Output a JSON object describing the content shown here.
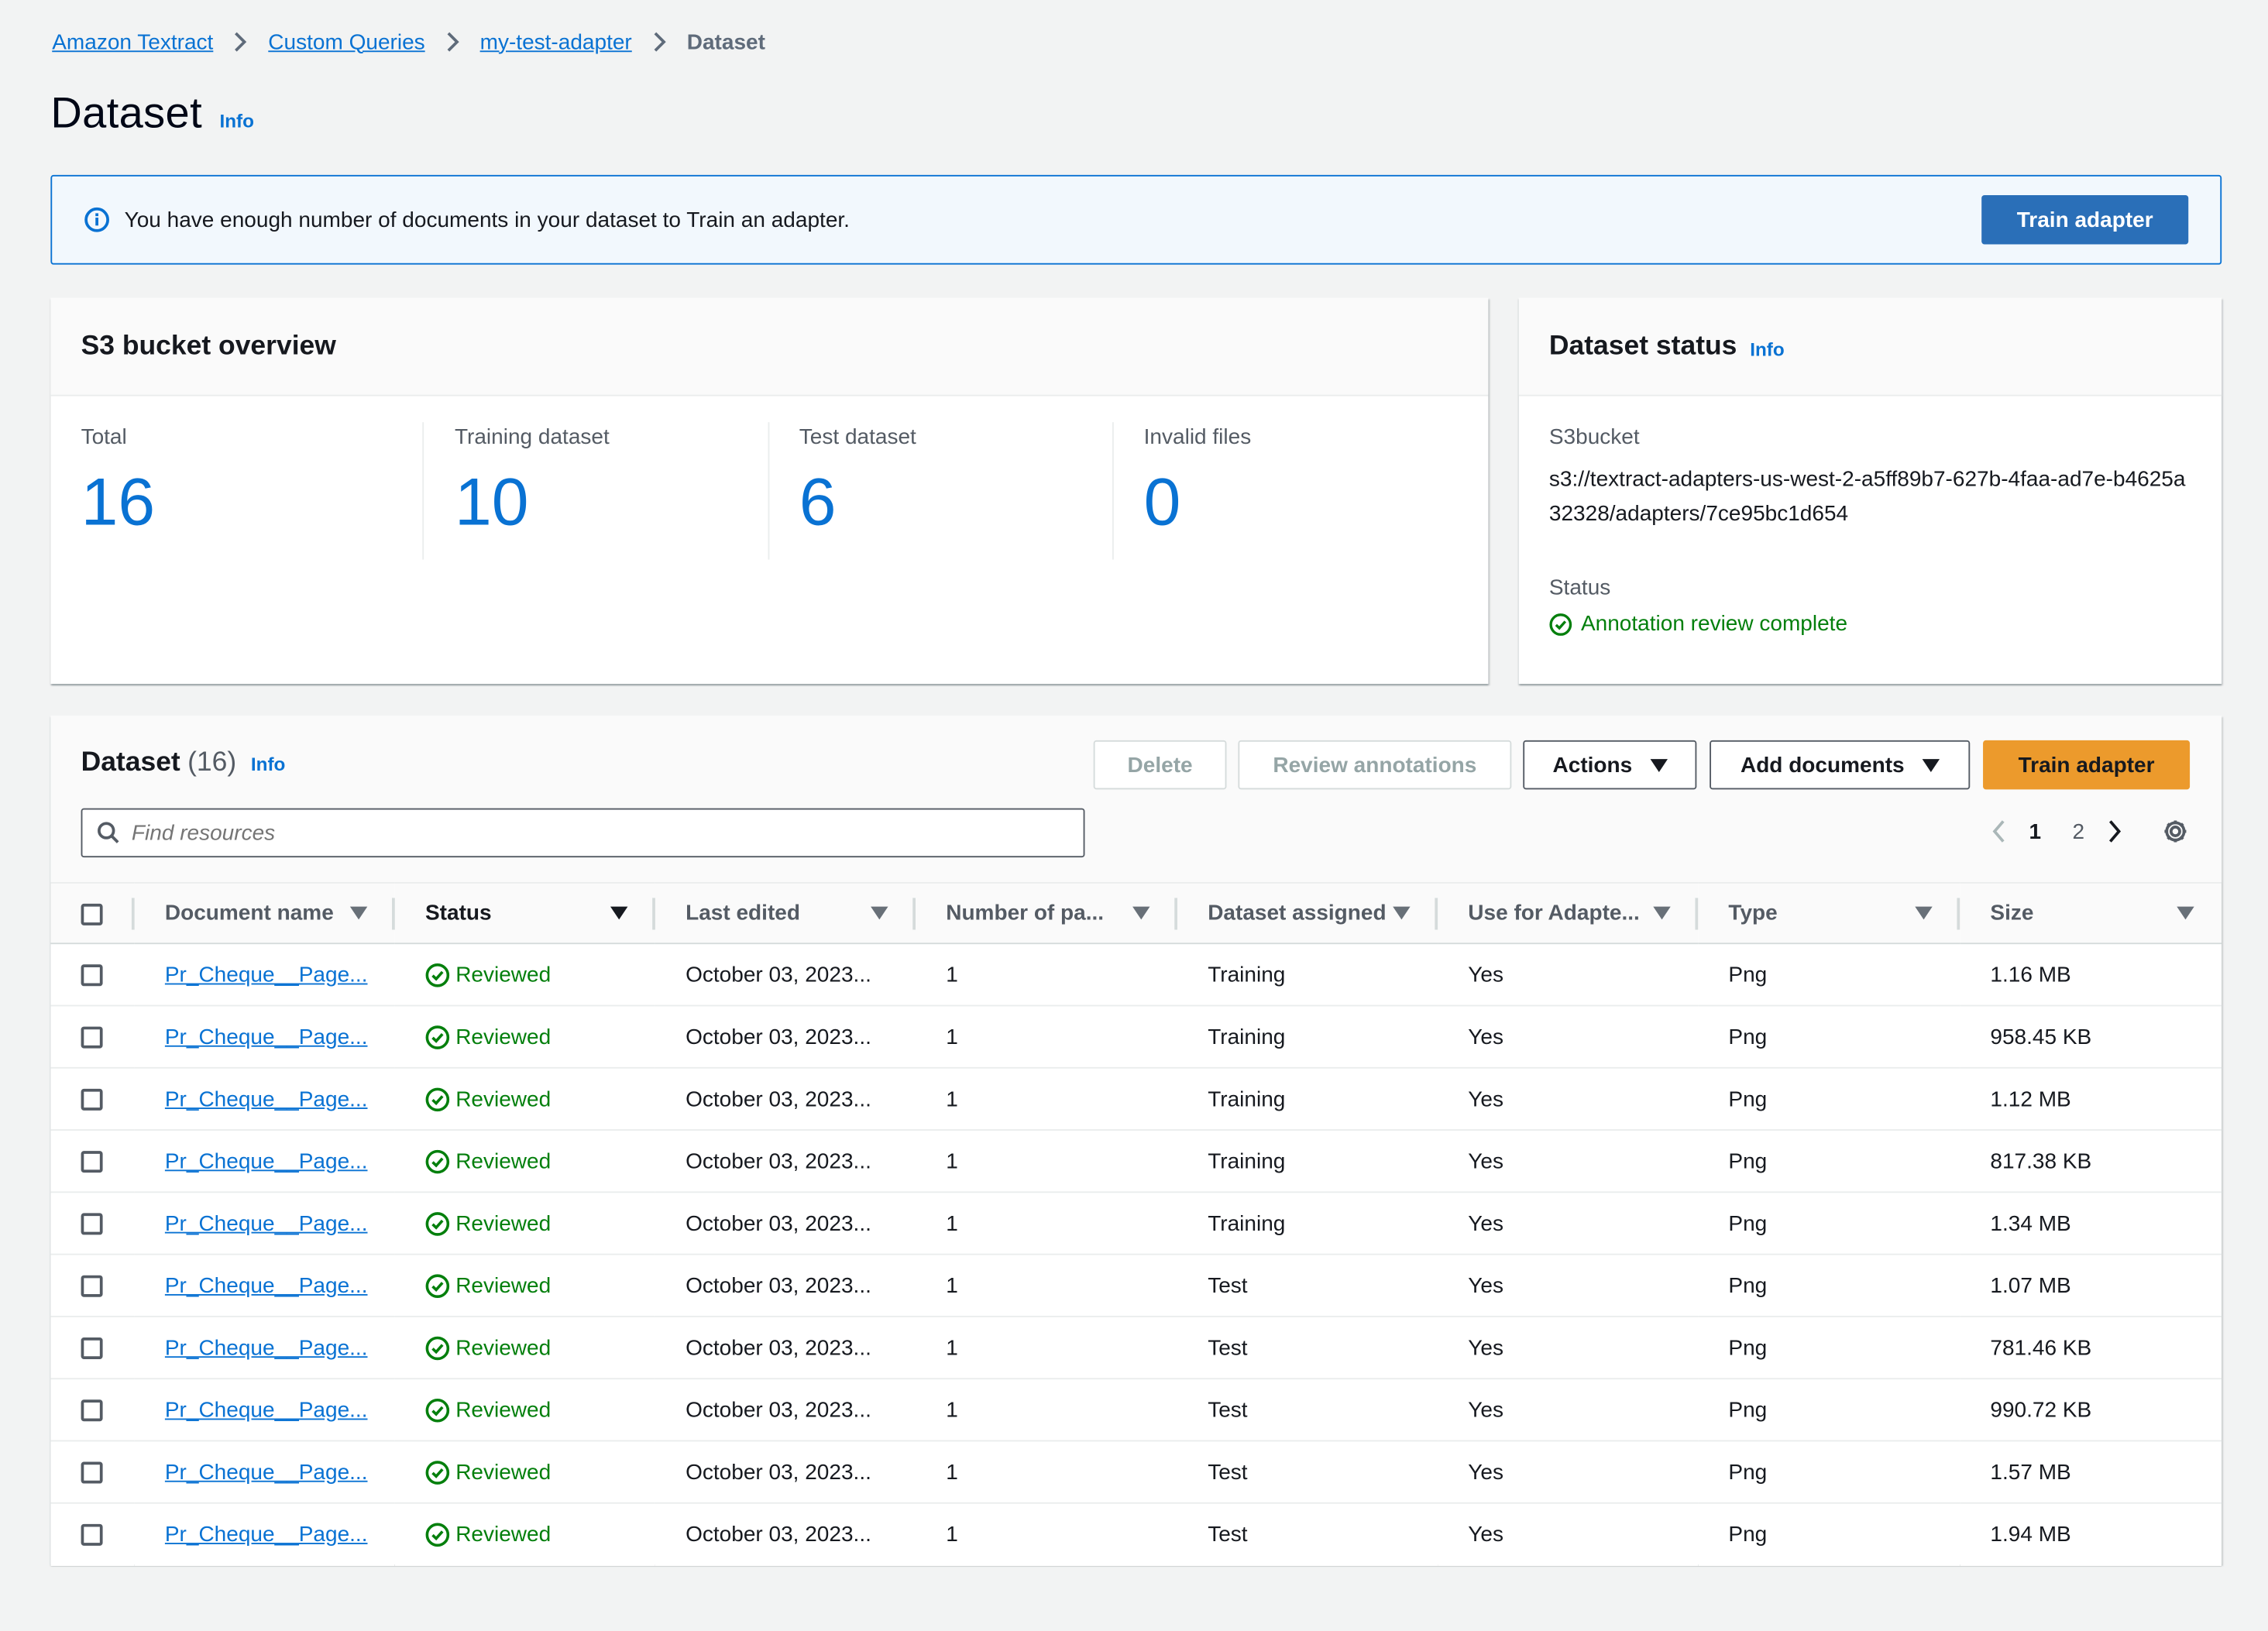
{
  "breadcrumb": [
    {
      "label": "Amazon Textract",
      "link": true
    },
    {
      "label": "Custom Queries",
      "link": true
    },
    {
      "label": "my-test-adapter",
      "link": true
    },
    {
      "label": "Dataset",
      "link": false
    }
  ],
  "page": {
    "title": "Dataset",
    "info": "Info"
  },
  "alert": {
    "message": "You have enough number of documents in your dataset to Train an adapter.",
    "button": "Train adapter",
    "icon": "info-circle-icon"
  },
  "s3_overview": {
    "title": "S3 bucket overview",
    "stats": [
      {
        "label": "Total",
        "value": "16"
      },
      {
        "label": "Training dataset",
        "value": "10"
      },
      {
        "label": "Test dataset",
        "value": "6"
      },
      {
        "label": "Invalid files",
        "value": "0"
      }
    ]
  },
  "dataset_status": {
    "title": "Dataset status",
    "info": "Info",
    "s3bucket_label": "S3bucket",
    "s3bucket_value": "s3://textract-adapters-us-west-2-a5ff89b7-627b-4faa-ad7e-b4625a32328/adapters/7ce95bc1d654",
    "status_label": "Status",
    "status_value": "Annotation review complete"
  },
  "table": {
    "title": "Dataset",
    "count": "(16)",
    "info": "Info",
    "buttons": {
      "delete": "Delete",
      "review": "Review annotations",
      "actions": "Actions",
      "add": "Add documents",
      "train": "Train adapter"
    },
    "search_placeholder": "Find resources",
    "pagination": {
      "pages": [
        "1",
        "2"
      ],
      "current": "1"
    },
    "columns": [
      "Document name",
      "Status",
      "Last edited",
      "Number of pa...",
      "Dataset assigned",
      "Use for Adapte...",
      "Type",
      "Size"
    ],
    "rows": [
      {
        "name": "Pr_Cheque__Page...",
        "status": "Reviewed",
        "edited": "October 03, 2023...",
        "pages": "1",
        "assigned": "Training",
        "use": "Yes",
        "type": "Png",
        "size": "1.16 MB"
      },
      {
        "name": "Pr_Cheque__Page...",
        "status": "Reviewed",
        "edited": "October 03, 2023...",
        "pages": "1",
        "assigned": "Training",
        "use": "Yes",
        "type": "Png",
        "size": "958.45 KB"
      },
      {
        "name": "Pr_Cheque__Page...",
        "status": "Reviewed",
        "edited": "October 03, 2023...",
        "pages": "1",
        "assigned": "Training",
        "use": "Yes",
        "type": "Png",
        "size": "1.12 MB"
      },
      {
        "name": "Pr_Cheque__Page...",
        "status": "Reviewed",
        "edited": "October 03, 2023...",
        "pages": "1",
        "assigned": "Training",
        "use": "Yes",
        "type": "Png",
        "size": "817.38 KB"
      },
      {
        "name": "Pr_Cheque__Page...",
        "status": "Reviewed",
        "edited": "October 03, 2023...",
        "pages": "1",
        "assigned": "Training",
        "use": "Yes",
        "type": "Png",
        "size": "1.34 MB"
      },
      {
        "name": "Pr_Cheque__Page...",
        "status": "Reviewed",
        "edited": "October 03, 2023...",
        "pages": "1",
        "assigned": "Test",
        "use": "Yes",
        "type": "Png",
        "size": "1.07 MB"
      },
      {
        "name": "Pr_Cheque__Page...",
        "status": "Reviewed",
        "edited": "October 03, 2023...",
        "pages": "1",
        "assigned": "Test",
        "use": "Yes",
        "type": "Png",
        "size": "781.46 KB"
      },
      {
        "name": "Pr_Cheque__Page...",
        "status": "Reviewed",
        "edited": "October 03, 2023...",
        "pages": "1",
        "assigned": "Test",
        "use": "Yes",
        "type": "Png",
        "size": "990.72 KB"
      },
      {
        "name": "Pr_Cheque__Page...",
        "status": "Reviewed",
        "edited": "October 03, 2023...",
        "pages": "1",
        "assigned": "Test",
        "use": "Yes",
        "type": "Png",
        "size": "1.57 MB"
      },
      {
        "name": "Pr_Cheque__Page...",
        "status": "Reviewed",
        "edited": "October 03, 2023...",
        "pages": "1",
        "assigned": "Test",
        "use": "Yes",
        "type": "Png",
        "size": "1.94 MB"
      }
    ]
  },
  "colors": {
    "link": "#0972d3",
    "success": "#037f0c",
    "primary_orange": "#ec9a2c",
    "primary_blue": "#2a6fb8"
  }
}
